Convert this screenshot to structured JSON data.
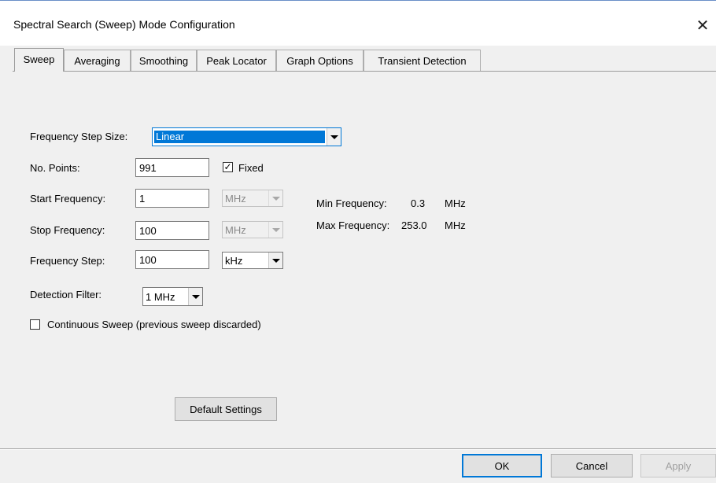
{
  "window": {
    "title": "Spectral Search (Sweep) Mode Configuration",
    "close_glyph": "✕"
  },
  "tabs": [
    {
      "label": "Sweep",
      "active": true
    },
    {
      "label": "Averaging",
      "active": false
    },
    {
      "label": "Smoothing",
      "active": false
    },
    {
      "label": "Peak Locator",
      "active": false
    },
    {
      "label": "Graph Options",
      "active": false
    },
    {
      "label": "Transient Detection",
      "active": false
    }
  ],
  "form": {
    "step_size_label": "Frequency Step Size:",
    "step_size_value": "Linear",
    "no_points_label": "No. Points:",
    "no_points_value": "991",
    "fixed_label": "Fixed",
    "fixed_checked": true,
    "start_label": "Start Frequency:",
    "start_value": "1",
    "start_unit": "MHz",
    "stop_label": "Stop Frequency:",
    "stop_value": "100",
    "stop_unit": "MHz",
    "step_label": "Frequency Step:",
    "step_value": "100",
    "step_unit": "kHz",
    "detection_label": "Detection Filter:",
    "detection_value": "1 MHz",
    "continuous_label": "Continuous Sweep (previous sweep discarded)",
    "continuous_checked": false,
    "min_freq_label": "Min Frequency:",
    "min_freq_value": "0.3",
    "min_freq_unit": "MHz",
    "max_freq_label": "Max Frequency:",
    "max_freq_value": "253.0",
    "max_freq_unit": "MHz",
    "default_button": "Default Settings"
  },
  "footer": {
    "ok": "OK",
    "cancel": "Cancel",
    "apply": "Apply"
  },
  "colors": {
    "selection": "#0078d7",
    "focus_border": "#0078d7"
  },
  "icons": {
    "close": "close-icon",
    "dropdown": "chevron-down-icon",
    "check": "checkmark-icon"
  }
}
